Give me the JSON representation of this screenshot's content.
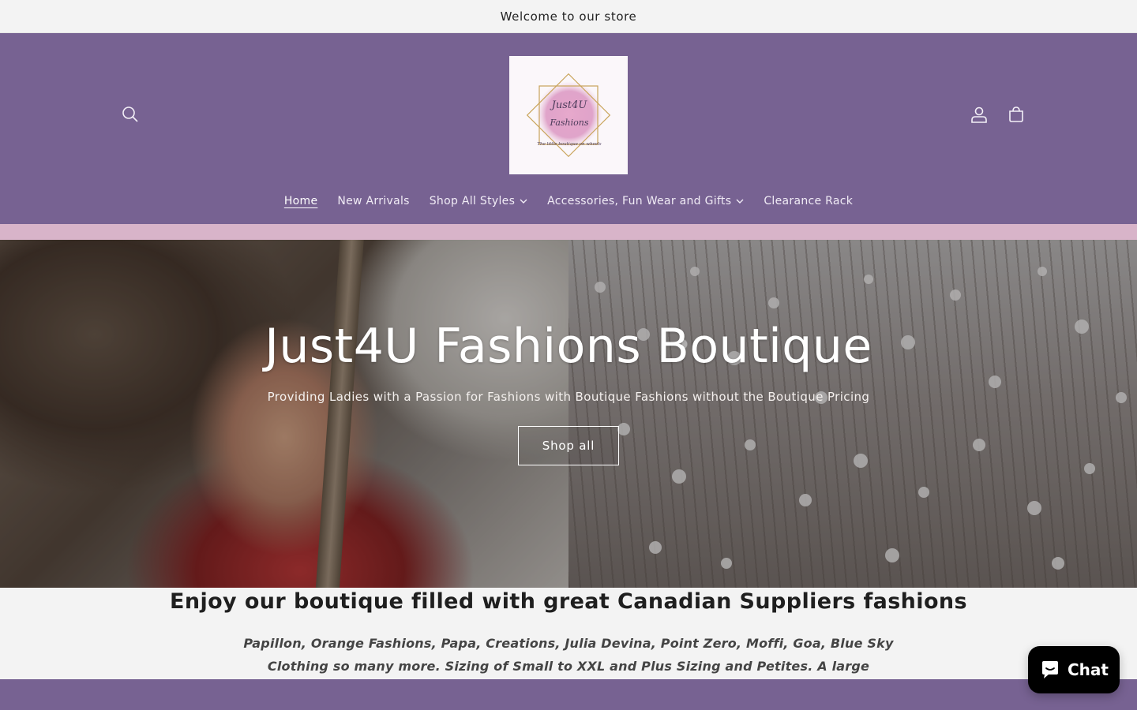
{
  "announcement": {
    "text": "Welcome to our store"
  },
  "header": {
    "logo": {
      "line1": "Just4U",
      "line2": "Fashions",
      "tagline": "The little boutique on wheels"
    },
    "icons": {
      "search": "search-icon",
      "account": "account-icon",
      "cart": "cart-icon"
    }
  },
  "nav": {
    "items": [
      {
        "label": "Home",
        "active": true
      },
      {
        "label": "New Arrivals"
      },
      {
        "label": "Shop All Styles",
        "dropdown": true
      },
      {
        "label": "Accessories, Fun Wear and Gifts",
        "dropdown": true
      },
      {
        "label": "Clearance Rack"
      }
    ]
  },
  "hero": {
    "title": "Just4U Fashions Boutique",
    "subtitle": "Providing Ladies with a Passion for Fashions with Boutique Fashions without the Boutique Pricing",
    "button": "Shop all"
  },
  "rich_text": {
    "heading": "Enjoy our boutique filled with great Canadian Suppliers fashions",
    "body": "Papillon, Orange Fashions, Papa, Creations, Julia Devina, Point Zero, Moffi, Goa, Blue Sky Clothing so many more. Sizing of Small to XXL and Plus Sizing and Petites. A large selection to serve many bodies."
  },
  "chat": {
    "label": "Chat"
  },
  "colors": {
    "header_bg": "#776292",
    "accent_bar": "#d8b4c9",
    "page_bg": "#f3f3f3",
    "chat_bg": "#000000"
  }
}
